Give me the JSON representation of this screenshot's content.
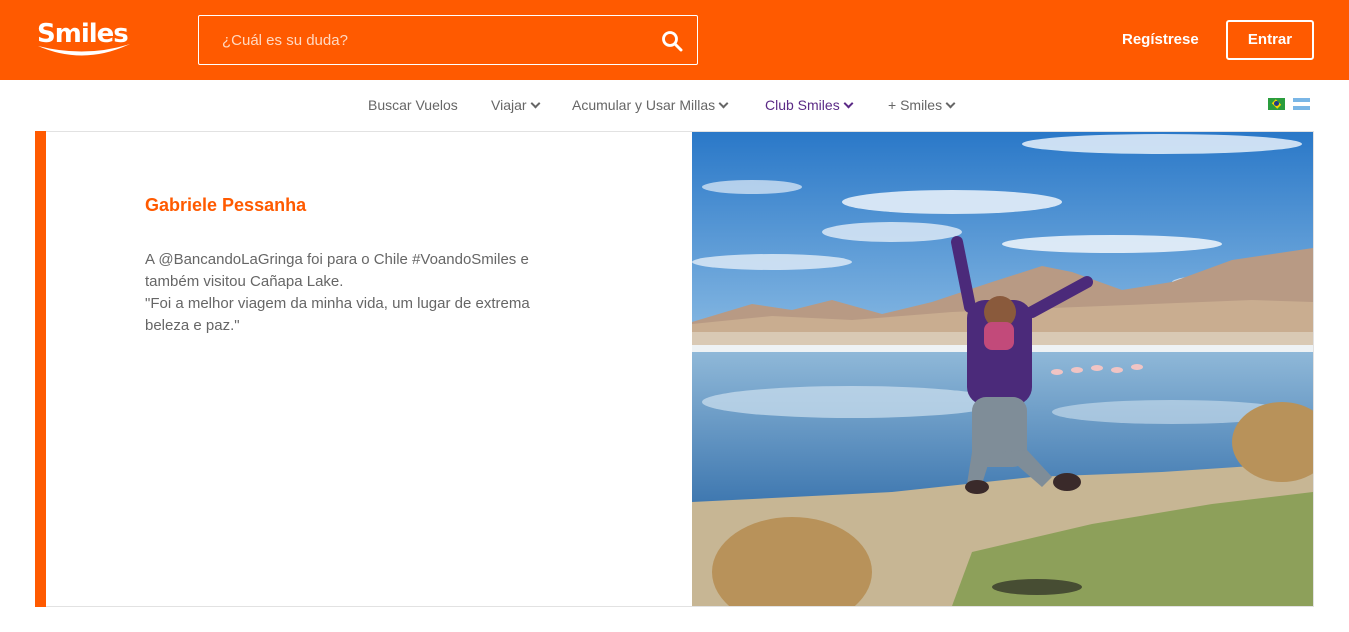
{
  "header": {
    "logo_text": "Smiles",
    "search": {
      "placeholder": "¿Cuál es su duda?",
      "value": ""
    },
    "register_label": "Regístrese",
    "login_label": "Entrar",
    "brand_color": "#ff5a00"
  },
  "nav": {
    "items": [
      {
        "label": "Buscar Vuelos",
        "has_dropdown": false
      },
      {
        "label": "Viajar",
        "has_dropdown": true
      },
      {
        "label": "Acumular y Usar Millas",
        "has_dropdown": true
      },
      {
        "label": "Club Smiles",
        "has_dropdown": true,
        "active": true
      },
      {
        "label": "+ Smiles",
        "has_dropdown": true
      }
    ],
    "flags": [
      "brazil-flag-icon",
      "argentina-flag-icon"
    ],
    "active_color": "#5b2a86"
  },
  "testimonial": {
    "name": "Gabriele Pessanha",
    "text_line1": "A @BancandoLaGringa foi para o Chile #VoandoSmiles e também visitou Cañapa Lake.",
    "text_line2": "\"Foi a melhor viagem da minha vida, um lugar de extrema beleza e paz.\""
  }
}
